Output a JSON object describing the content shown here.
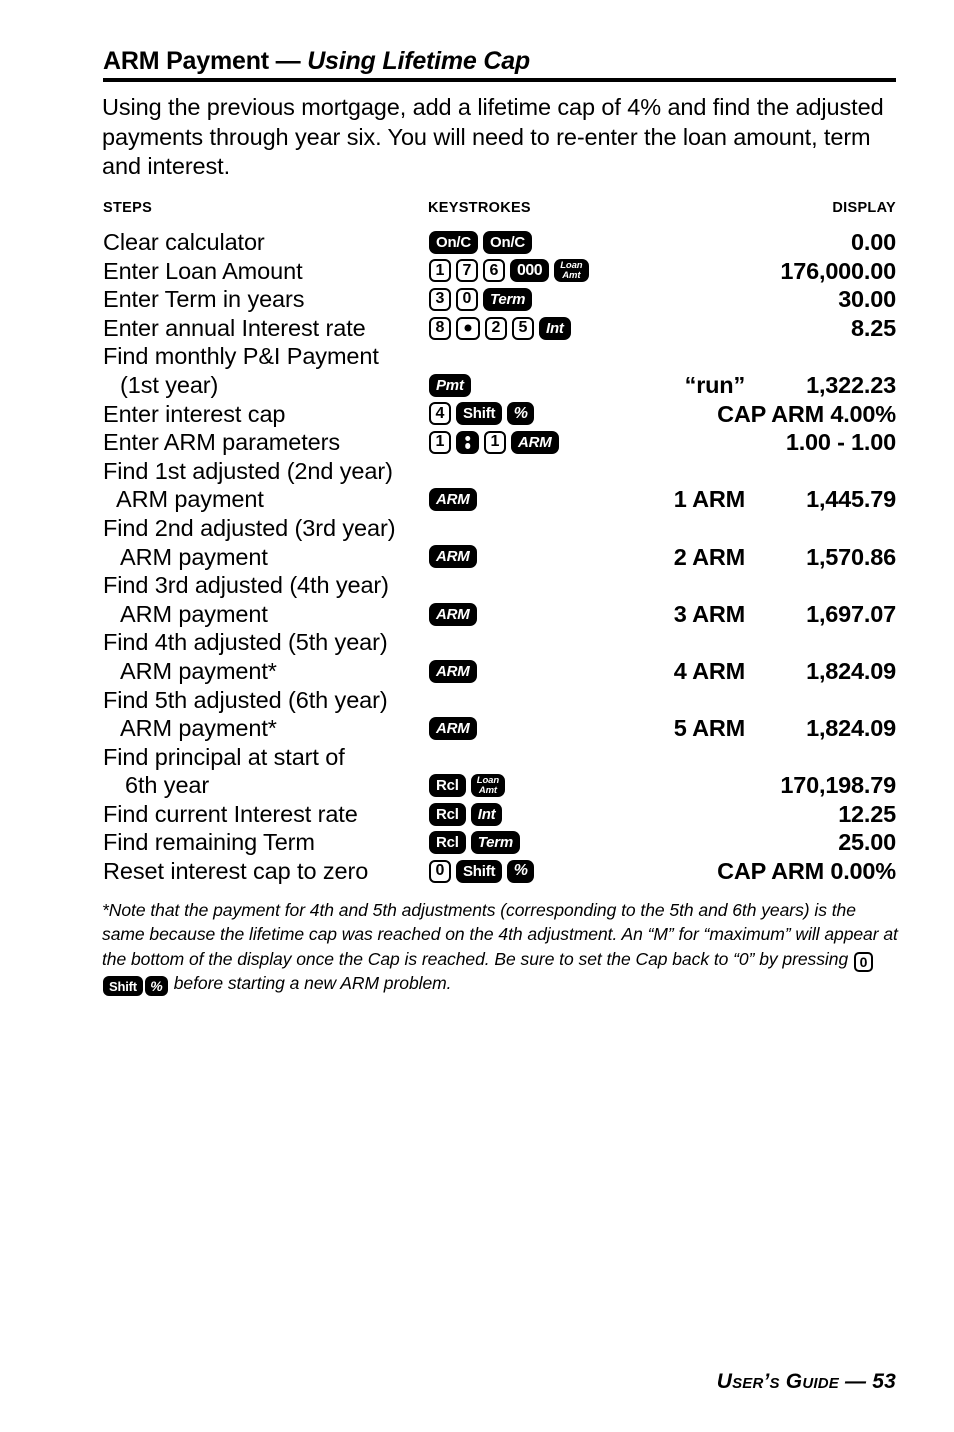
{
  "title": {
    "main": "ARM Payment — ",
    "emphasis": "Using Lifetime Cap"
  },
  "intro": "Using the previous mortgage, add a lifetime cap of 4% and find the adjusted payments through year six. You will need to re-enter the loan amount, term and interest.",
  "columns": {
    "steps": "STEPS",
    "keystrokes": "KEYSTROKES",
    "display": "DISPLAY"
  },
  "rows": [
    {
      "step": "Clear calculator",
      "indent": 0,
      "keys": [
        {
          "type": "fn",
          "label": "On/C",
          "style": "upright"
        },
        {
          "type": "fn",
          "label": "On/C",
          "style": "upright"
        }
      ],
      "display_tag": "",
      "display_value": "0.00"
    },
    {
      "step": "Enter Loan Amount",
      "indent": 0,
      "keys": [
        {
          "type": "num",
          "label": "1"
        },
        {
          "type": "num",
          "label": "7"
        },
        {
          "type": "num",
          "label": "6"
        },
        {
          "type": "triple-zero",
          "label": "000"
        },
        {
          "type": "twoline",
          "line1": "Loan",
          "line2": "Amt"
        }
      ],
      "display_tag": "",
      "display_value": "176,000.00"
    },
    {
      "step": "Enter Term in years",
      "indent": 0,
      "keys": [
        {
          "type": "num",
          "label": "3"
        },
        {
          "type": "num",
          "label": "0"
        },
        {
          "type": "fn",
          "label": "Term"
        }
      ],
      "display_tag": "",
      "display_value": "30.00"
    },
    {
      "step": "Enter annual Interest rate",
      "indent": 0,
      "keys": [
        {
          "type": "num",
          "label": "8"
        },
        {
          "type": "dot",
          "label": "."
        },
        {
          "type": "num",
          "label": "2"
        },
        {
          "type": "num",
          "label": "5"
        },
        {
          "type": "fn",
          "label": "Int"
        }
      ],
      "display_tag": "",
      "display_value": "8.25"
    },
    {
      "step": "Find monthly P&I Payment",
      "indent": 0,
      "keys": [],
      "display_tag": "",
      "display_value": ""
    },
    {
      "step": "(1st year)",
      "indent": 2,
      "keys": [
        {
          "type": "fn",
          "label": "Pmt"
        }
      ],
      "display_tag": "“run”",
      "display_value": "1,322.23"
    },
    {
      "step": "Enter interest cap",
      "indent": 0,
      "keys": [
        {
          "type": "num",
          "label": "4"
        },
        {
          "type": "fn",
          "label": "Shift",
          "style": "upright"
        },
        {
          "type": "pct",
          "label": "%"
        }
      ],
      "display_tag": "",
      "display_value": "CAP ARM 4.00%"
    },
    {
      "step": "Enter ARM parameters",
      "indent": 0,
      "keys": [
        {
          "type": "num",
          "label": "1"
        },
        {
          "type": "colon",
          "label": ":"
        },
        {
          "type": "num",
          "label": "1"
        },
        {
          "type": "fn",
          "label": "ARM"
        }
      ],
      "display_tag": "",
      "display_value": "1.00 - 1.00"
    },
    {
      "step": "Find 1st adjusted (2nd year)",
      "indent": 0,
      "keys": [],
      "display_tag": "",
      "display_value": ""
    },
    {
      "step": "ARM payment",
      "indent": 1,
      "keys": [
        {
          "type": "fn",
          "label": "ARM"
        }
      ],
      "display_tag": "1 ARM",
      "display_value": "1,445.79"
    },
    {
      "step": "Find 2nd adjusted (3rd year)",
      "indent": 0,
      "keys": [],
      "display_tag": "",
      "display_value": ""
    },
    {
      "step": "ARM payment",
      "indent": 2,
      "keys": [
        {
          "type": "fn",
          "label": "ARM"
        }
      ],
      "display_tag": "2 ARM",
      "display_value": "1,570.86"
    },
    {
      "step": "Find 3rd adjusted (4th year)",
      "indent": 0,
      "keys": [],
      "display_tag": "",
      "display_value": ""
    },
    {
      "step": "ARM payment",
      "indent": 2,
      "keys": [
        {
          "type": "fn",
          "label": "ARM"
        }
      ],
      "display_tag": "3 ARM",
      "display_value": "1,697.07"
    },
    {
      "step": "Find 4th adjusted (5th year)",
      "indent": 0,
      "keys": [],
      "display_tag": "",
      "display_value": ""
    },
    {
      "step": "ARM payment*",
      "indent": 2,
      "keys": [
        {
          "type": "fn",
          "label": "ARM"
        }
      ],
      "display_tag": "4 ARM",
      "display_value": "1,824.09"
    },
    {
      "step": "Find 5th adjusted (6th year)",
      "indent": 0,
      "keys": [],
      "display_tag": "",
      "display_value": ""
    },
    {
      "step": "ARM payment*",
      "indent": 2,
      "keys": [
        {
          "type": "fn",
          "label": "ARM"
        }
      ],
      "display_tag": "5 ARM",
      "display_value": "1,824.09"
    },
    {
      "step": "Find principal at start of",
      "indent": 0,
      "keys": [],
      "display_tag": "",
      "display_value": ""
    },
    {
      "step": "6th year",
      "indent": 3,
      "keys": [
        {
          "type": "fn",
          "label": "Rcl",
          "style": "upright"
        },
        {
          "type": "twoline",
          "line1": "Loan",
          "line2": "Amt"
        }
      ],
      "display_tag": "",
      "display_value": "170,198.79"
    },
    {
      "step": "Find current Interest rate",
      "indent": 0,
      "keys": [
        {
          "type": "fn",
          "label": "Rcl",
          "style": "upright"
        },
        {
          "type": "fn",
          "label": "Int"
        }
      ],
      "display_tag": "",
      "display_value": "12.25"
    },
    {
      "step": "Find remaining Term",
      "indent": 0,
      "keys": [
        {
          "type": "fn",
          "label": "Rcl",
          "style": "upright"
        },
        {
          "type": "fn",
          "label": "Term"
        }
      ],
      "display_tag": "",
      "display_value": "25.00"
    },
    {
      "step": "Reset interest cap to zero",
      "indent": 0,
      "keys": [
        {
          "type": "num",
          "label": "0"
        },
        {
          "type": "fn",
          "label": "Shift",
          "style": "upright"
        },
        {
          "type": "pct",
          "label": "%"
        }
      ],
      "display_tag": "",
      "display_value": "CAP ARM 0.00%"
    }
  ],
  "footnote": {
    "part1": "*Note that the payment for 4th and 5th adjustments (corresponding to the 5th and 6th years) is the same because the lifetime cap was reached on the 4th adjustment. An “M” for “maximum” will appear at the bottom of the display once the Cap is reached. Be sure to set the Cap back to “0” by pressing ",
    "key_zero": "0",
    "key_shift": "Shift",
    "key_pct": "%",
    "part2": " before starting a new ARM problem."
  },
  "footer": {
    "guide": "User’s Guide — ",
    "page": "53"
  }
}
